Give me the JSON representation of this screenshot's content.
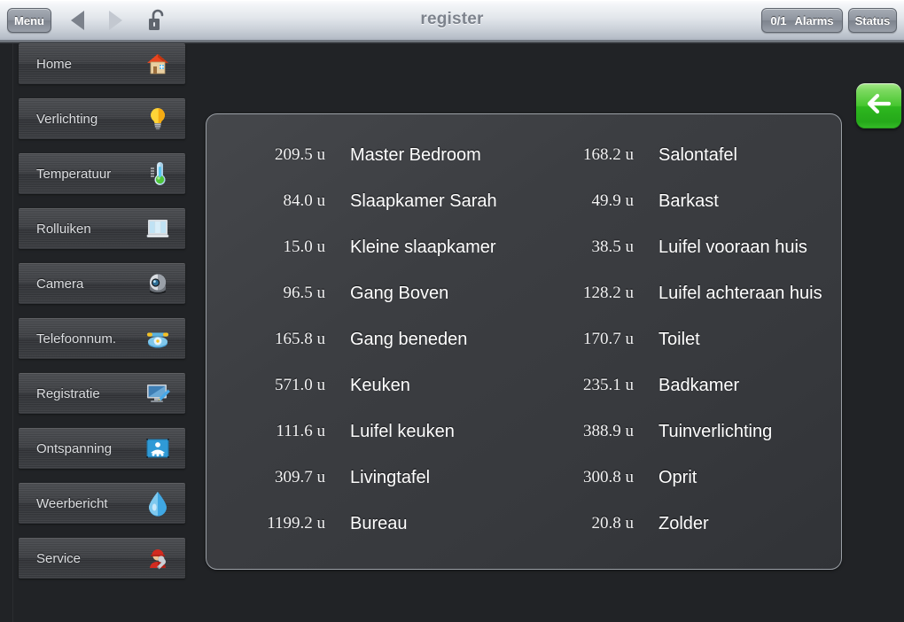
{
  "topbar": {
    "menu_label": "Menu",
    "title": "register",
    "back_arrow_icon": "triangle-left-icon",
    "forward_arrow_icon": "triangle-right-icon",
    "lock_icon": "unlocked-padlock-icon",
    "alarms_count": "0/1",
    "alarms_label": "Alarms",
    "status_label": "Status"
  },
  "sidebar": {
    "items": [
      {
        "label": "Home",
        "icon": "house-icon"
      },
      {
        "label": "Verlichting",
        "icon": "lightbulb-icon"
      },
      {
        "label": "Temperatuur",
        "icon": "thermometer-icon"
      },
      {
        "label": "Rolluiken",
        "icon": "window-blinds-icon"
      },
      {
        "label": "Camera",
        "icon": "dome-camera-icon"
      },
      {
        "label": "Telefoonnum.",
        "icon": "telephone-icon"
      },
      {
        "label": "Registratie",
        "icon": "monitor-pencil-icon"
      },
      {
        "label": "Ontspanning",
        "icon": "spa-person-icon"
      },
      {
        "label": "Weerbericht",
        "icon": "water-drop-icon"
      },
      {
        "label": "Service",
        "icon": "worker-wrench-icon"
      }
    ]
  },
  "panel": {
    "left_column": [
      {
        "value": "209.5 u",
        "label": "Master Bedroom"
      },
      {
        "value": "84.0 u",
        "label": "Slaapkamer Sarah"
      },
      {
        "value": "15.0 u",
        "label": "Kleine slaapkamer"
      },
      {
        "value": "96.5 u",
        "label": "Gang Boven"
      },
      {
        "value": "165.8 u",
        "label": "Gang beneden"
      },
      {
        "value": "571.0 u",
        "label": "Keuken"
      },
      {
        "value": "111.6 u",
        "label": "Luifel keuken"
      },
      {
        "value": "309.7 u",
        "label": "Livingtafel"
      },
      {
        "value": "1199.2 u",
        "label": "Bureau"
      }
    ],
    "right_column": [
      {
        "value": "168.2 u",
        "label": "Salontafel"
      },
      {
        "value": "49.9 u",
        "label": "Barkast"
      },
      {
        "value": "38.5 u",
        "label": "Luifel vooraan huis"
      },
      {
        "value": "128.2 u",
        "label": "Luifel achteraan huis"
      },
      {
        "value": "170.7 u",
        "label": "Toilet"
      },
      {
        "value": "235.1 u",
        "label": "Badkamer"
      },
      {
        "value": "388.9 u",
        "label": "Tuinverlichting"
      },
      {
        "value": "300.8 u",
        "label": "Oprit"
      },
      {
        "value": "20.8 u",
        "label": "Zolder"
      }
    ]
  },
  "back_button": {
    "icon": "arrow-left-icon"
  },
  "colors": {
    "accent_green": "#35bc28",
    "panel_border": "#9ba0a6",
    "page_background": "#212326",
    "topbar_text": "#7d838d"
  }
}
